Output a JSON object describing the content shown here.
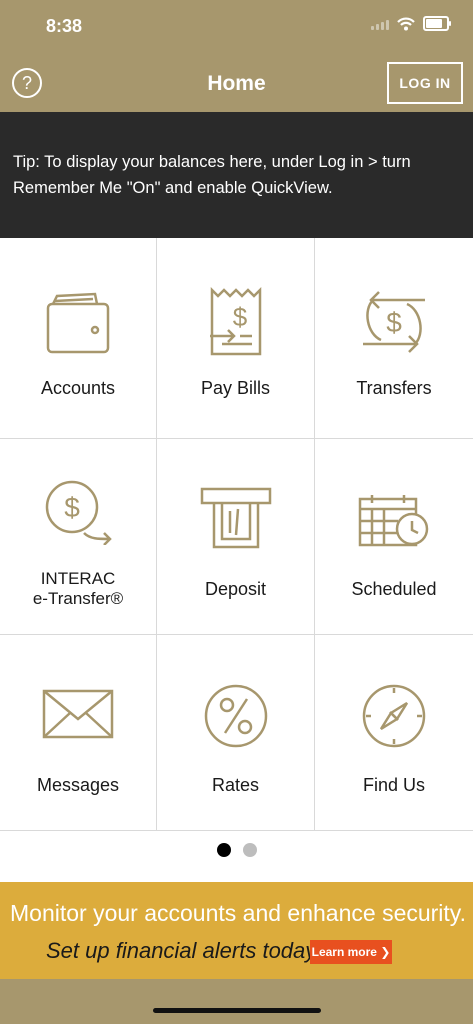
{
  "status": {
    "time": "8:38"
  },
  "nav": {
    "help_label": "?",
    "title": "Home",
    "login_label": "LOG IN"
  },
  "tip": {
    "text": "Tip: To display your balances here, under Log in > turn Remember Me \"On\" and enable QuickView."
  },
  "tiles": [
    {
      "label": "Accounts",
      "icon": "wallet-icon"
    },
    {
      "label": "Pay Bills",
      "icon": "bill-icon"
    },
    {
      "label": "Transfers",
      "icon": "transfer-icon"
    },
    {
      "label_line1": "INTERAC",
      "label_line2": "e-Transfer®",
      "icon": "etransfer-icon"
    },
    {
      "label": "Deposit",
      "icon": "atm-icon"
    },
    {
      "label": "Scheduled",
      "icon": "calendar-clock-icon"
    },
    {
      "label": "Messages",
      "icon": "envelope-icon"
    },
    {
      "label": "Rates",
      "icon": "percent-icon"
    },
    {
      "label": "Find Us",
      "icon": "compass-icon"
    }
  ],
  "pager": {
    "pages": 2,
    "current": 1
  },
  "banner": {
    "line1": "Monitor your accounts and enhance security.",
    "line2": "Set up financial alerts today.",
    "cta": "Learn more ❯"
  },
  "colors": {
    "brand": "#a7976d",
    "tip_bg": "#2a2a2a",
    "banner_bg": "#dcac3c",
    "cta": "#e8501f",
    "icon": "#a7976d"
  }
}
